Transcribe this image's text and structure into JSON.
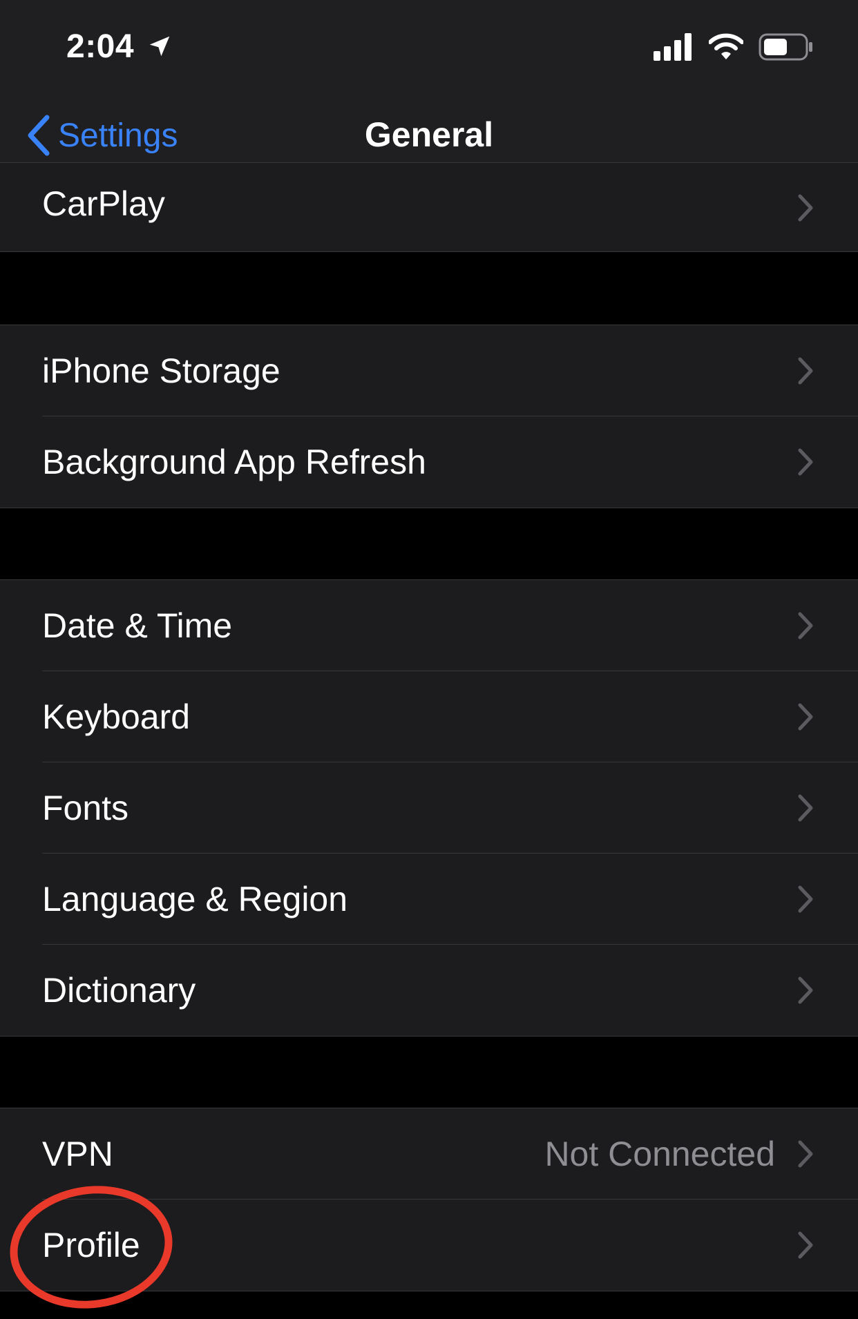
{
  "status_bar": {
    "time": "2:04",
    "icons": [
      "location-arrow-icon",
      "cellular-signal-icon",
      "wifi-icon",
      "battery-icon"
    ]
  },
  "nav": {
    "back_label": "Settings",
    "title": "General"
  },
  "groups": [
    {
      "rows": [
        {
          "label": "CarPlay",
          "value": ""
        }
      ]
    },
    {
      "rows": [
        {
          "label": "iPhone Storage",
          "value": ""
        },
        {
          "label": "Background App Refresh",
          "value": ""
        }
      ]
    },
    {
      "rows": [
        {
          "label": "Date & Time",
          "value": ""
        },
        {
          "label": "Keyboard",
          "value": ""
        },
        {
          "label": "Fonts",
          "value": ""
        },
        {
          "label": "Language & Region",
          "value": ""
        },
        {
          "label": "Dictionary",
          "value": ""
        }
      ]
    },
    {
      "rows": [
        {
          "label": "VPN",
          "value": "Not Connected"
        },
        {
          "label": "Profile",
          "value": ""
        }
      ]
    }
  ],
  "colors": {
    "accent": "#3a82f7",
    "cell_background": "#1c1c1e",
    "group_separator": "#000000",
    "secondary_text": "#8e8e93",
    "annotation_ring": "#e8392a"
  }
}
